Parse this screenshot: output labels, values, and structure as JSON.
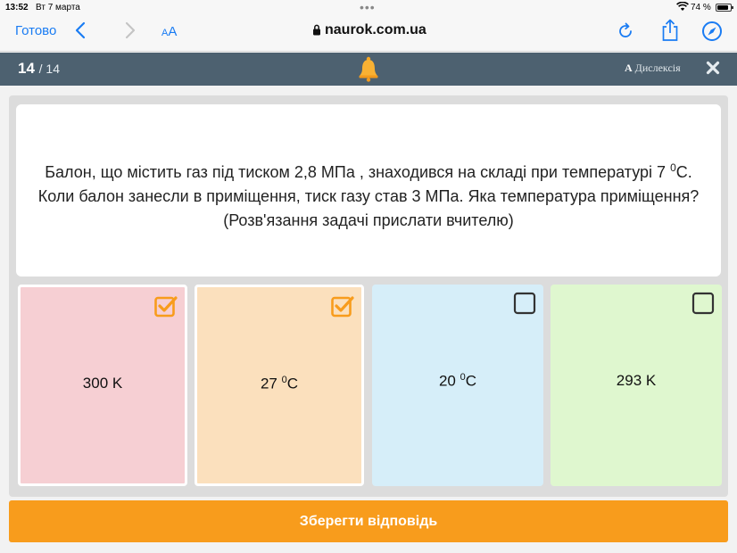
{
  "statusbar": {
    "time": "13:52",
    "date": "Вт 7 марта",
    "battery": "74 %"
  },
  "browser": {
    "done_label": "Готово",
    "text_size_label_small": "A",
    "text_size_label_large": "A",
    "url": "naurok.com.ua"
  },
  "quiz": {
    "current": "14",
    "total": "/ 14",
    "dyslexia_letter": "A",
    "dyslexia_label": "Дислексія",
    "question_part1": "Балон, що містить газ під тиском 2,8 МПа , знаходився на складі при температурі 7 ",
    "question_sup": "0",
    "question_part2": "С. Коли балон занесли в приміщення, тиск газу став 3 МПа. Яка температура приміщення? (Розв'язання задачі прислати вчителю)",
    "options": [
      {
        "main": "300 K",
        "sup": "",
        "unit": "",
        "selected": true
      },
      {
        "main": "27 ",
        "sup": "0",
        "unit": "C",
        "selected": true
      },
      {
        "main": "20 ",
        "sup": "0",
        "unit": "C",
        "selected": false
      },
      {
        "main": "293 K",
        "sup": "",
        "unit": "",
        "selected": false
      }
    ],
    "save_label": "Зберегти відповідь"
  },
  "colors": {
    "accent_orange": "#f89c1c",
    "header_bg": "#4d6170",
    "ios_blue": "#1a7cf3",
    "option1_bg": "#f6cfd3",
    "option2_bg": "#fbe0bd",
    "option3_bg": "#d6eef9",
    "option4_bg": "#dff7cf"
  }
}
